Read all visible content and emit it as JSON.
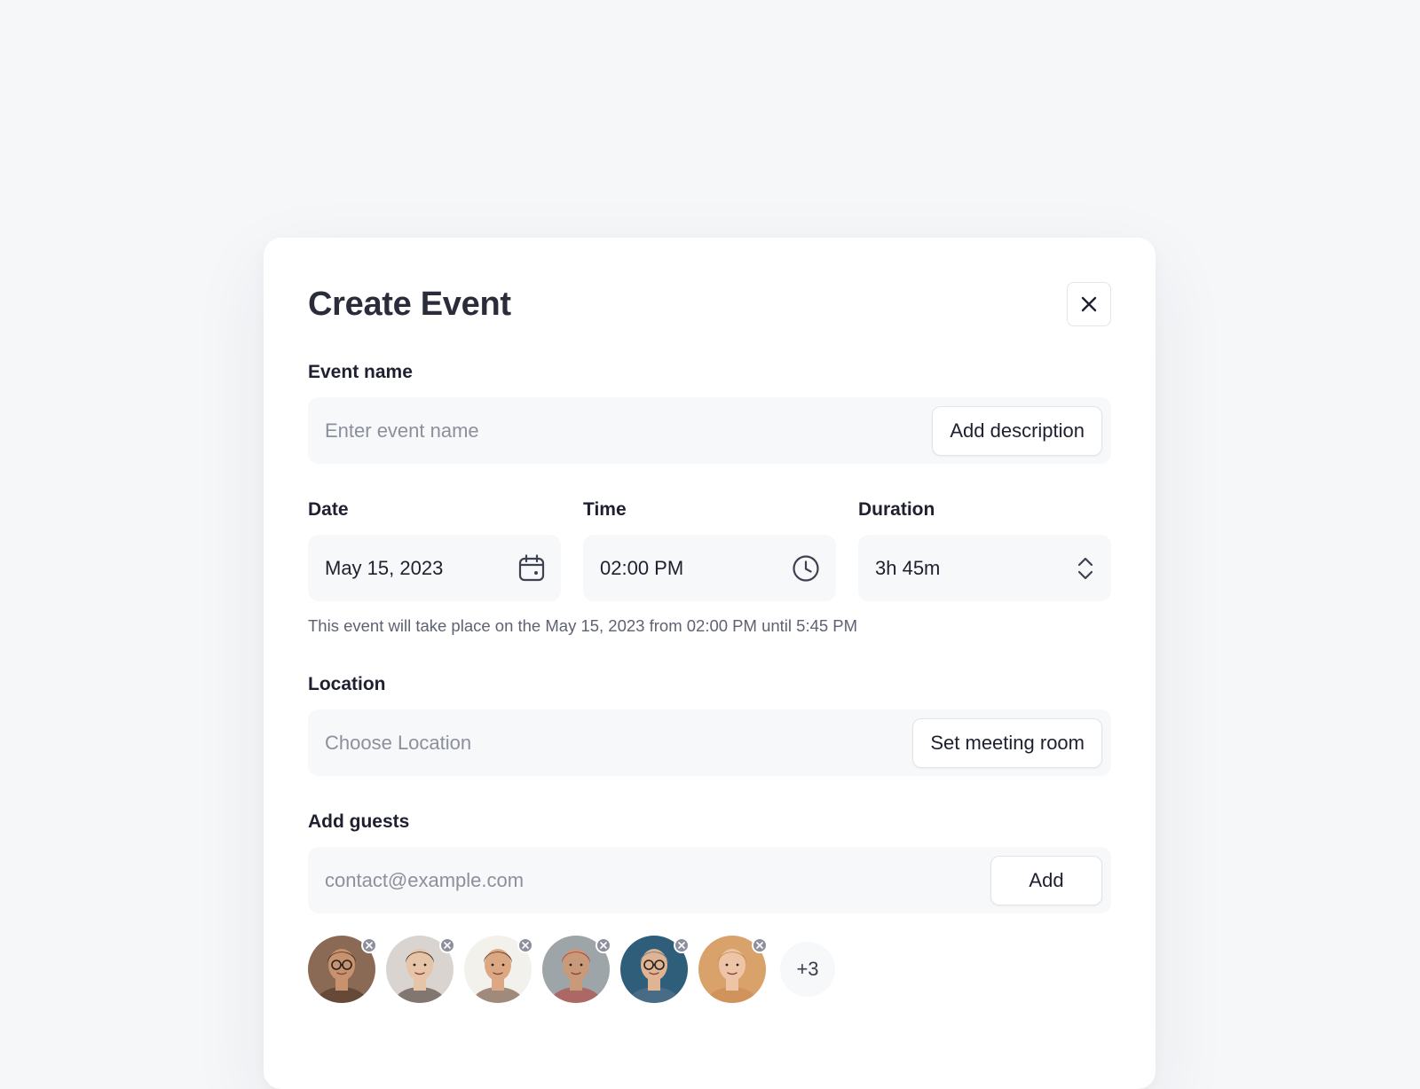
{
  "modal": {
    "title": "Create Event"
  },
  "event_name": {
    "label": "Event name",
    "placeholder": "Enter event name",
    "value": "",
    "add_description_label": "Add description"
  },
  "date": {
    "label": "Date",
    "value": "May 15, 2023",
    "icon": "calendar-icon"
  },
  "time": {
    "label": "Time",
    "value": "02:00 PM",
    "icon": "clock-icon"
  },
  "duration": {
    "label": "Duration",
    "value": "3h 45m",
    "icon": "chevron-up-down-icon"
  },
  "helper_text": "This event will take place on the May 15, 2023 from 02:00 PM until 5:45 PM",
  "location": {
    "label": "Location",
    "placeholder": "Choose Location",
    "value": "",
    "set_room_label": "Set meeting room"
  },
  "guests": {
    "label": "Add guests",
    "placeholder": "contact@example.com",
    "value": "",
    "add_label": "Add",
    "avatars": [
      {
        "skin": "#c9926e",
        "hair": "#4a2e20",
        "bg": "#8a6a55",
        "glasses": true
      },
      {
        "skin": "#e6c4a8",
        "hair": "#3b2a22",
        "bg": "#d9d4cf",
        "glasses": false
      },
      {
        "skin": "#dca883",
        "hair": "#5a3420",
        "bg": "#f3f1ec",
        "glasses": false
      },
      {
        "skin": "#c89a7a",
        "hair": "#b8362c",
        "bg": "#9ea5a8",
        "glasses": false
      },
      {
        "skin": "#e0b392",
        "hair": "#5f7890",
        "bg": "#2f5e7a",
        "glasses": true
      },
      {
        "skin": "#edc4a6",
        "hair": "#c9864f",
        "bg": "#d8a26a",
        "glasses": false
      }
    ],
    "more_count": "+3"
  },
  "colors": {
    "input_bg": "#f7f8fa",
    "border": "#e2e4e9",
    "text": "#1e2030",
    "muted": "#5e6272",
    "placeholder": "#8c8f9c"
  }
}
